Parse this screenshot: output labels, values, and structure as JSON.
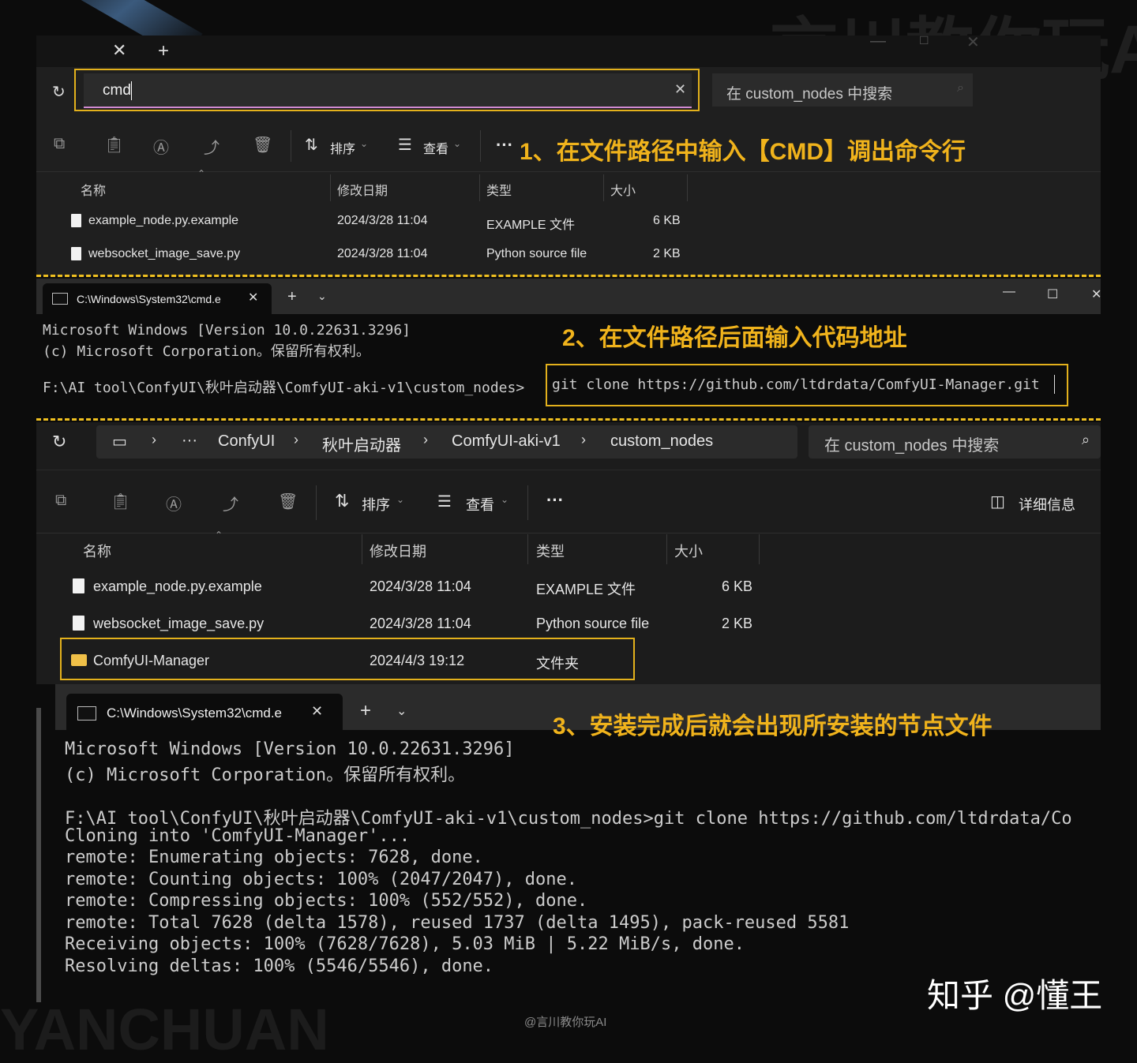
{
  "watermarks": {
    "top_right": "言川教你玩AI",
    "bottom_left": "YANCHUAN",
    "bottom_center": "@言川教你玩AI",
    "zhihu": "知乎 @懂王"
  },
  "panel1": {
    "address_value": "cmd",
    "search_placeholder": "在 custom_nodes 中搜索",
    "sort_label": "排序",
    "view_label": "查看",
    "more_label": "···",
    "annotation": "1、在文件路径中输入【CMD】调出命令行",
    "columns": [
      "名称",
      "修改日期",
      "类型",
      "大小"
    ],
    "rows": [
      {
        "name": "example_node.py.example",
        "date": "2024/3/28 11:04",
        "type": "EXAMPLE 文件",
        "size": "6 KB"
      },
      {
        "name": "websocket_image_save.py",
        "date": "2024/3/28 11:04",
        "type": "Python source file",
        "size": "2 KB"
      }
    ]
  },
  "panel2": {
    "tab_title": "C:\\Windows\\System32\\cmd.e",
    "line1": "Microsoft Windows [Version 10.0.22631.3296]",
    "line2": "(c) Microsoft Corporation。保留所有权利。",
    "prompt": "F:\\AI tool\\ConfyUI\\秋叶启动器\\ComfyUI-aki-v1\\custom_nodes>",
    "command": "git clone https://github.com/ltdrdata/ComfyUI-Manager.git",
    "annotation": "2、在文件路径后面输入代码地址"
  },
  "panel3": {
    "breadcrumb": [
      "···",
      "ConfyUI",
      "秋叶启动器",
      "ComfyUI-aki-v1",
      "custom_nodes"
    ],
    "search_placeholder": "在 custom_nodes 中搜索",
    "sort_label": "排序",
    "view_label": "查看",
    "more_label": "···",
    "details_label": "详细信息",
    "columns": [
      "名称",
      "修改日期",
      "类型",
      "大小"
    ],
    "rows": [
      {
        "name": "example_node.py.example",
        "date": "2024/3/28 11:04",
        "type": "EXAMPLE 文件",
        "size": "6 KB"
      },
      {
        "name": "websocket_image_save.py",
        "date": "2024/3/28 11:04",
        "type": "Python source file",
        "size": "2 KB"
      },
      {
        "name": "ComfyUI-Manager",
        "date": "2024/4/3 19:12",
        "type": "文件夹",
        "size": ""
      }
    ]
  },
  "panel4": {
    "tab_title": "C:\\Windows\\System32\\cmd.e",
    "annotation": "3、安装完成后就会出现所安装的节点文件",
    "lines": [
      "Microsoft Windows [Version 10.0.22631.3296]",
      "(c) Microsoft Corporation。保留所有权利。",
      "",
      "F:\\AI tool\\ConfyUI\\秋叶启动器\\ComfyUI-aki-v1\\custom_nodes>git clone https://github.com/ltdrdata/Co",
      "Cloning into 'ComfyUI-Manager'...",
      "remote: Enumerating objects: 7628, done.",
      "remote: Counting objects: 100% (2047/2047), done.",
      "remote: Compressing objects: 100% (552/552), done.",
      "remote: Total 7628 (delta 1578), reused 1737 (delta 1495), pack-reused 5581",
      "Receiving objects: 100% (7628/7628), 5.03 MiB | 5.22 MiB/s, done.",
      "Resolving deltas: 100% (5546/5546), done."
    ]
  },
  "colors": {
    "accent": "#f0b31c",
    "panel": "#1c1c1c",
    "terminal": "#0c0c0c"
  }
}
